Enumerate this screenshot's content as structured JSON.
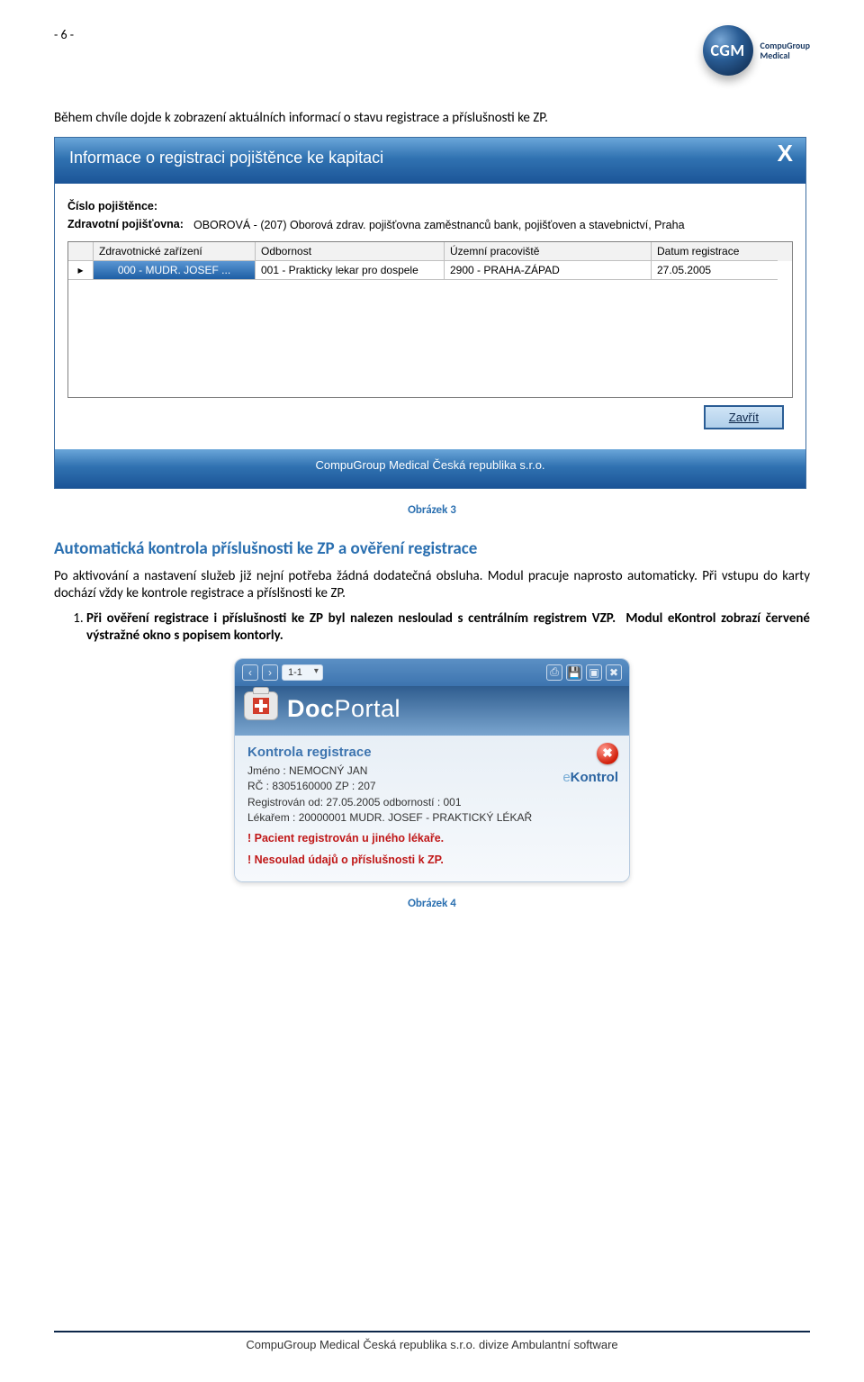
{
  "page_number_top": "- 6 -",
  "logo": {
    "abbr": "CGM",
    "brand1": "CompuGroup",
    "brand2": "Medical"
  },
  "para1": "Během chvíle dojde k zobrazení aktuálních informací o stavu registrace a příslušnosti ke ZP.",
  "dialog1": {
    "title": "Informace o registraci pojištěnce ke kapitaci",
    "labels": {
      "cislo": "Číslo pojištěnce:",
      "zp": "Zdravotní pojišťovna:"
    },
    "values": {
      "cislo": " ",
      "zp": "OBOROVÁ - (207) Oborová zdrav. pojišťovna zaměstnanců bank, pojišťoven a stavebnictví, Praha"
    },
    "cols": {
      "a": "Zdravotnické zařízení",
      "b": "Odbornost",
      "c": "Územní pracoviště",
      "d": "Datum registrace"
    },
    "row1": {
      "mark": "▸",
      "a": "000 - MUDR. JOSEF ...",
      "b": "001 - Prakticky lekar pro dospele",
      "c": "2900 - PRAHA-ZÁPAD",
      "d": "27.05.2005"
    },
    "btn_close": "Zavřít",
    "footer": "CompuGroup Medical Česká republika s.r.o."
  },
  "caption3": "Obrázek 3",
  "heading2": "Automatická kontrola příslušnosti ke ZP a ověření registrace",
  "para2": "Po aktivování a nastavení služeb již nejní potřeba žádná dodatečná obsluha. Modul pracuje naprosto automaticky. Při vstupu do karty dochází vždy ke kontrole registrace a příslšnosti ke ZP.",
  "list": {
    "n1_a": "Při ověření registrace i příslušnosti ke ZP byl nalezen nesloulad s centrálním registrem VZP.",
    "n1_b": "Modul eKontrol zobrazí červené výstražné okno s popisem kontorly."
  },
  "dp": {
    "pager": "1-1",
    "title_a": "Doc",
    "title_b": "Portal",
    "sub": "Kontrola registrace",
    "ek_e": "e",
    "ek_k": "Kontrol",
    "status_icon": "✖",
    "lines": [
      "Jméno : NEMOCNÝ JAN",
      "RČ       : 8305160000  ZP : 207",
      "Registrován od: 27.05.2005 odborností : 001",
      "Lékařem : 20000001 MUDR. JOSEF - PRAKTICKÝ LÉKAŘ"
    ],
    "warn": [
      "! Pacient registrován u jiného lékaře.",
      "! Nesoulad údajů o příslušnosti k ZP."
    ],
    "icons": {
      "left": [
        "‹",
        "›"
      ],
      "right": [
        "⎙",
        "💾",
        "▣",
        "✖"
      ]
    }
  },
  "caption4": "Obrázek 4",
  "footer": "CompuGroup Medical Česká republika s.r.o. divize Ambulantní software"
}
